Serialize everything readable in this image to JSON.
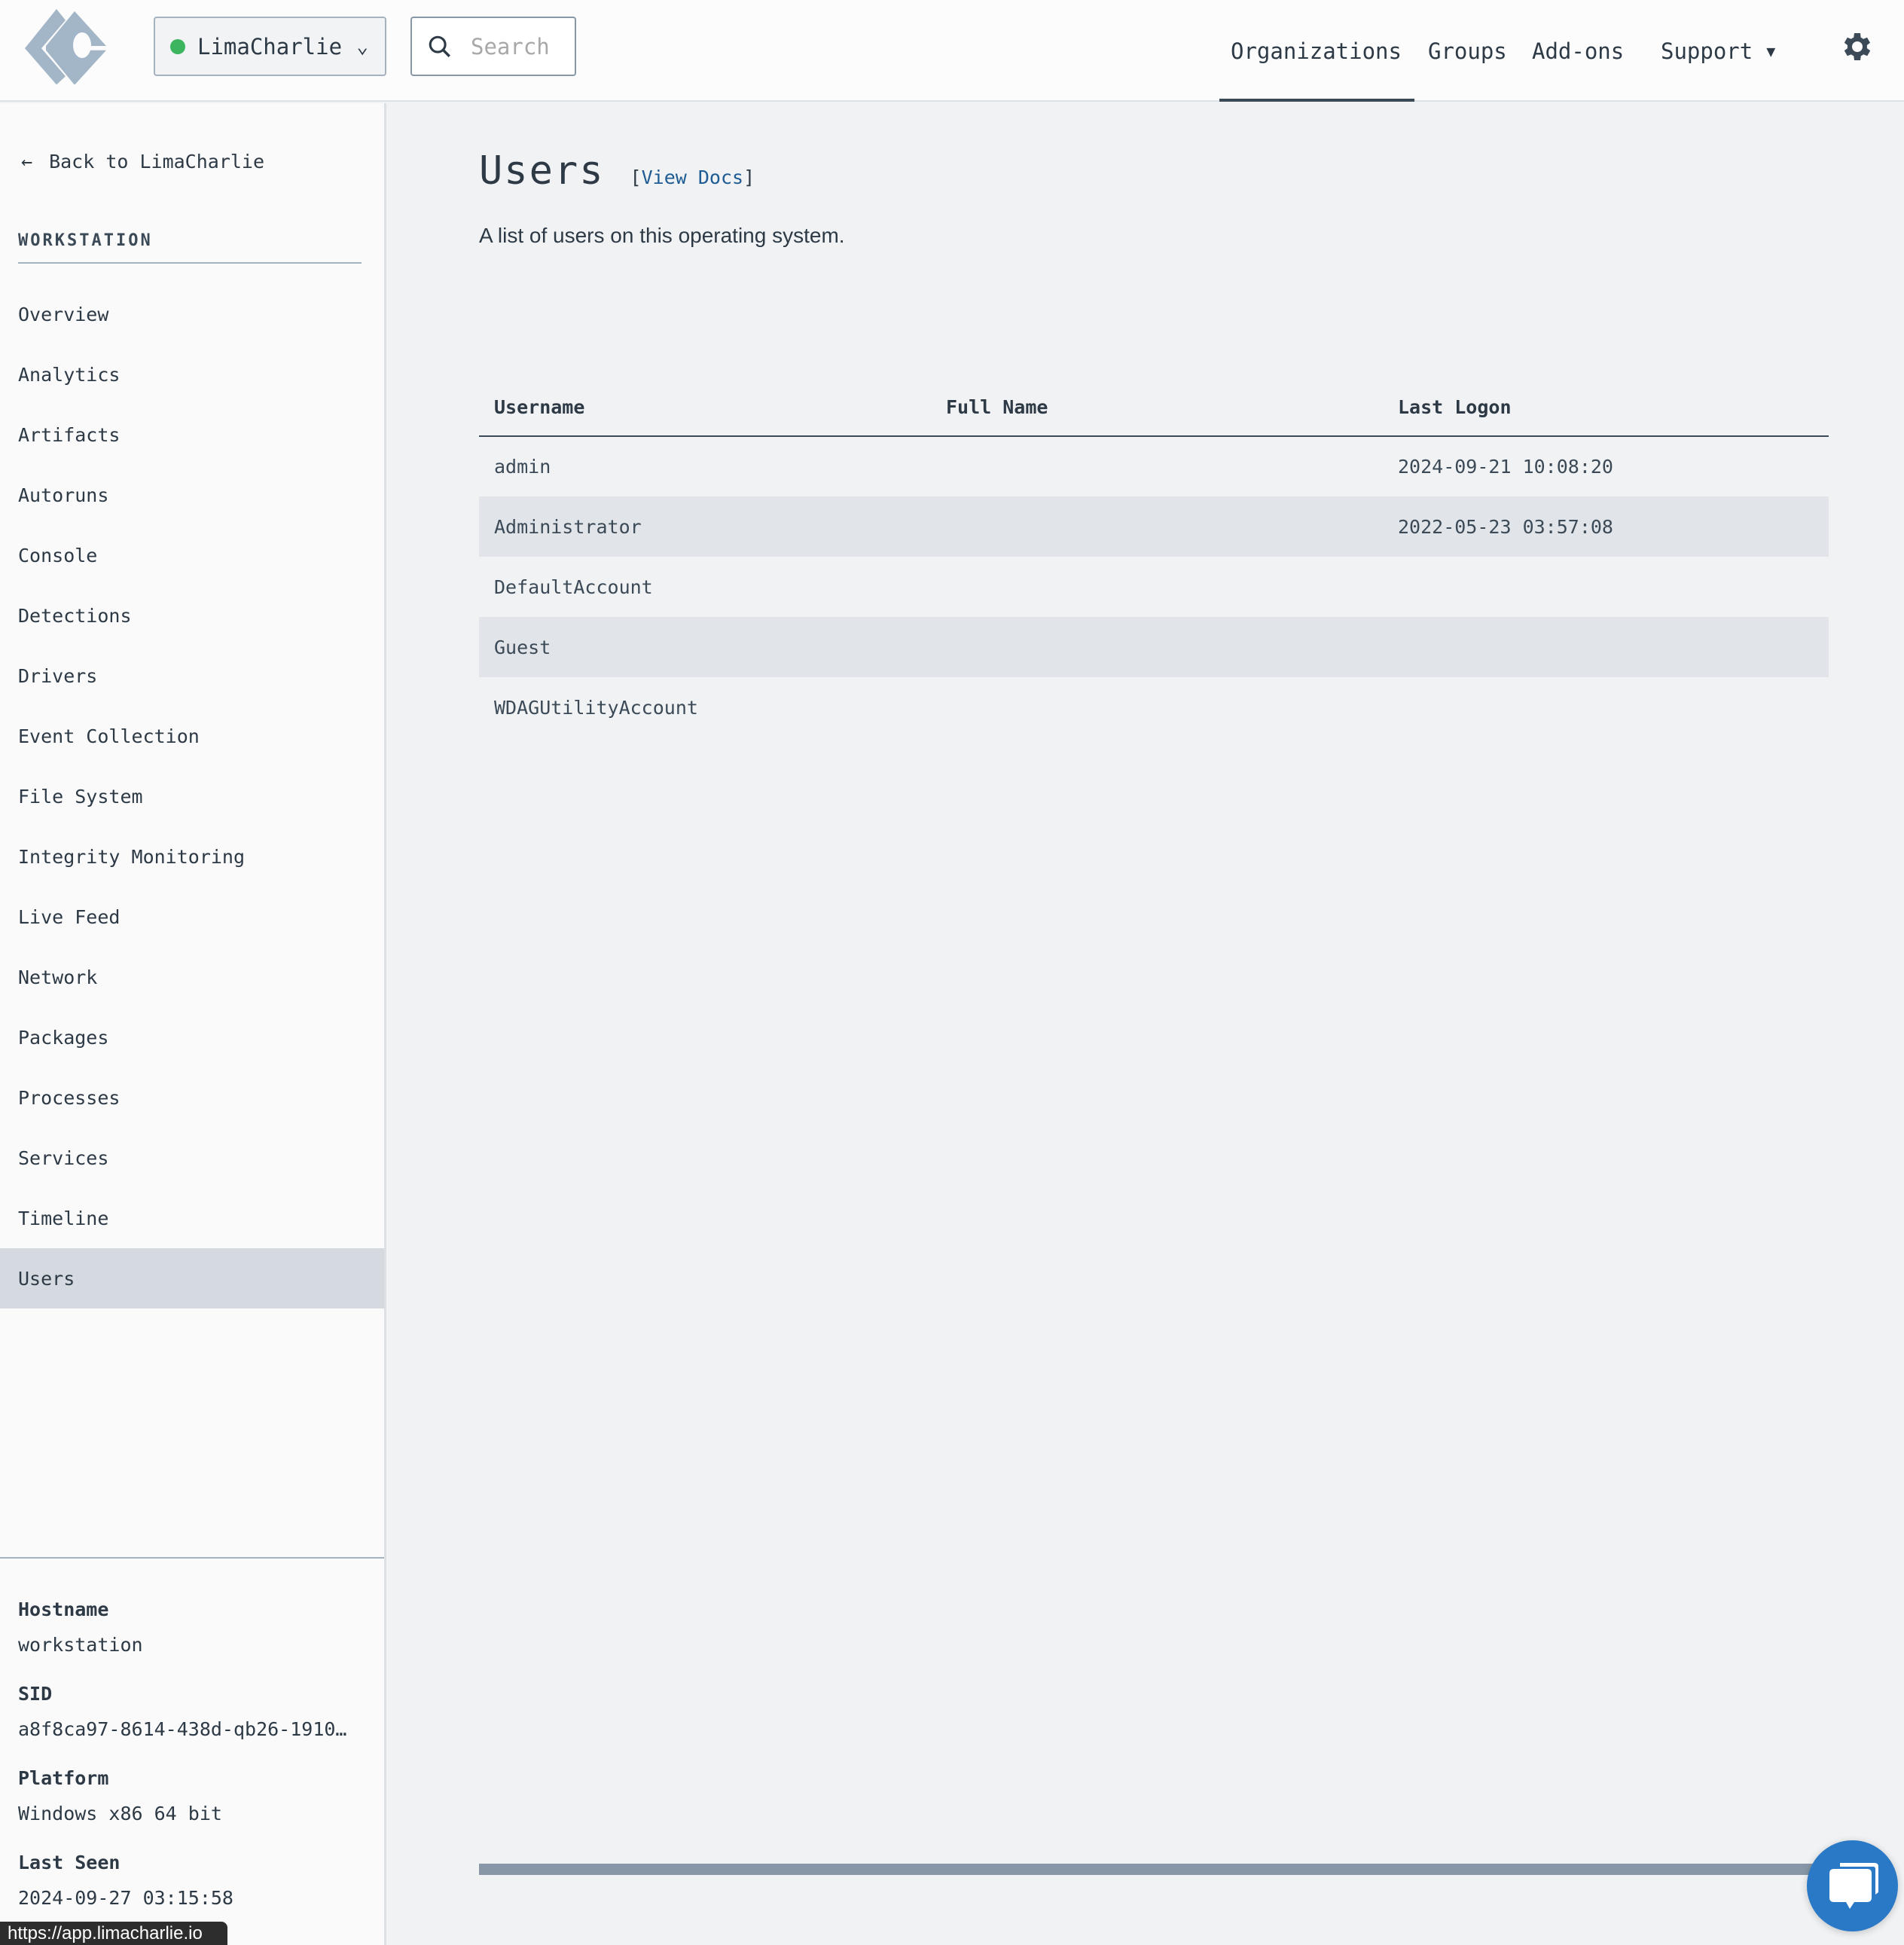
{
  "header": {
    "org_name": "LimaCharlie",
    "org_status_color": "#3cb55e",
    "search_placeholder": "Search",
    "nav": [
      {
        "label": "Organizations",
        "active": true
      },
      {
        "label": "Groups"
      },
      {
        "label": "Add-ons"
      },
      {
        "label": "Support"
      }
    ]
  },
  "sidebar": {
    "back_label": "Back to LimaCharlie",
    "section": "WORKSTATION",
    "items": [
      "Overview",
      "Analytics",
      "Artifacts",
      "Autoruns",
      "Console",
      "Detections",
      "Drivers",
      "Event Collection",
      "File System",
      "Integrity Monitoring",
      "Live Feed",
      "Network",
      "Packages",
      "Processes",
      "Services",
      "Timeline",
      "Users"
    ],
    "selected": "Users",
    "meta": [
      {
        "label": "Hostname",
        "value": "workstation"
      },
      {
        "label": "SID",
        "value": "a8f8ca97-8614-438d-qb26-1910…"
      },
      {
        "label": "Platform",
        "value": "Windows x86 64 bit"
      },
      {
        "label": "Last Seen",
        "value": "2024-09-27 03:15:58"
      }
    ]
  },
  "main": {
    "title": "Users",
    "docs_open": "[",
    "docs_label": "View Docs",
    "docs_close": "]",
    "description": "A list of users on this operating system.",
    "columns": [
      "Username",
      "Full Name",
      "Last Logon"
    ],
    "rows": [
      [
        "admin",
        "",
        "2024-09-21 10:08:20"
      ],
      [
        "Administrator",
        "",
        "2022-05-23 03:57:08"
      ],
      [
        "DefaultAccount",
        "",
        ""
      ],
      [
        "Guest",
        "",
        ""
      ],
      [
        "WDAGUtilityAccount",
        "",
        ""
      ]
    ]
  },
  "status_url": "https://app.limacharlie.io",
  "colors": {
    "accent": "#2979c7",
    "link": "#1f5c94"
  }
}
